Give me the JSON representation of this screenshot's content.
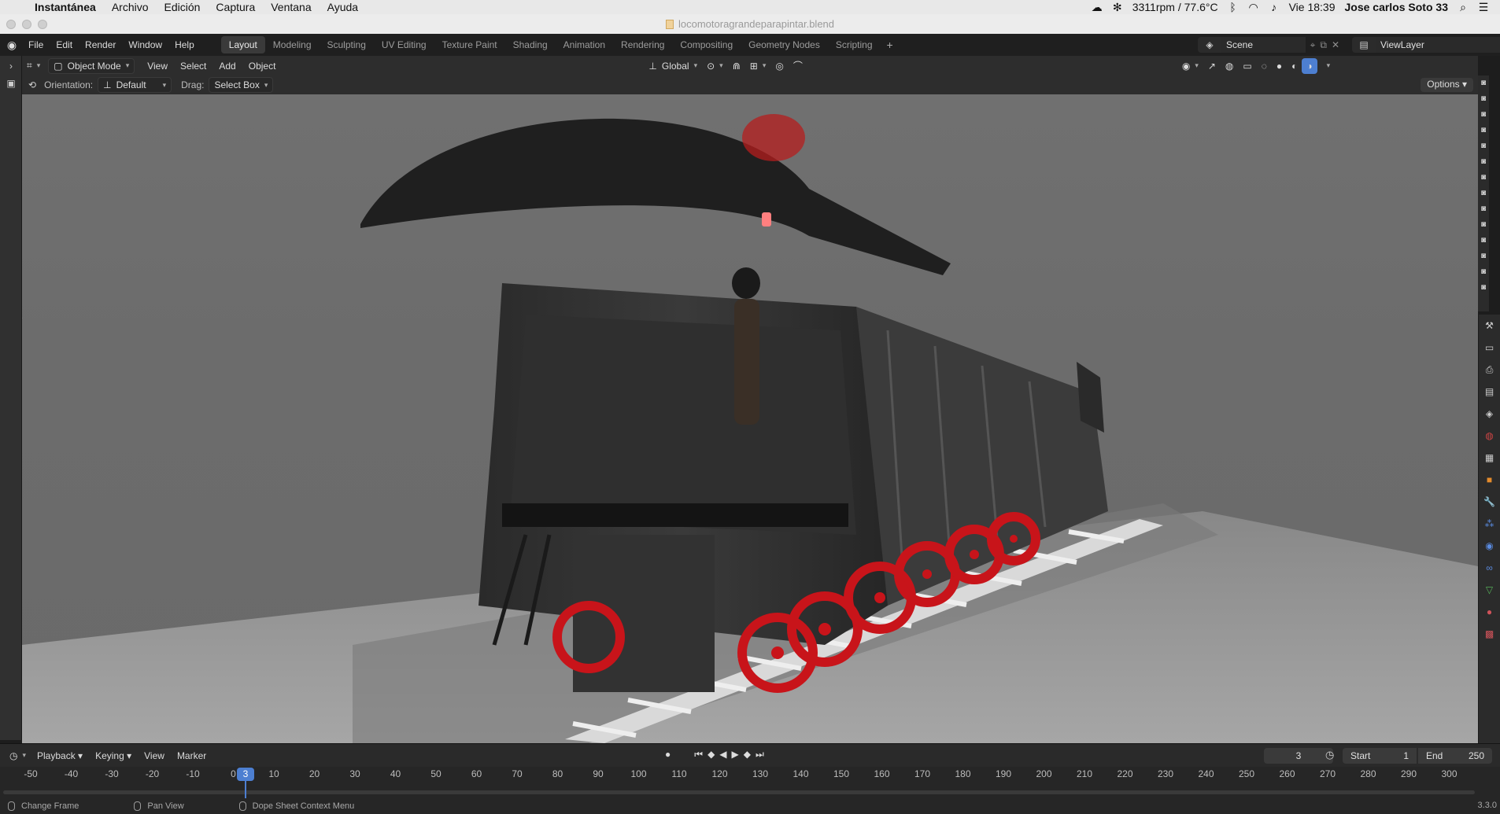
{
  "macos_menubar": {
    "app_name": "Instantánea",
    "items": [
      "Archivo",
      "Edición",
      "Captura",
      "Ventana",
      "Ayuda"
    ],
    "fan_status": "3311rpm / 77.6°C",
    "datetime": "Vie 18:39",
    "user": "Jose carlos Soto 33"
  },
  "window": {
    "title": "locomotoragrandeparapintar.blend"
  },
  "blender_menu": [
    "File",
    "Edit",
    "Render",
    "Window",
    "Help"
  ],
  "workspace_tabs": [
    {
      "label": "Layout",
      "active": true
    },
    {
      "label": "Modeling",
      "active": false
    },
    {
      "label": "Sculpting",
      "active": false
    },
    {
      "label": "UV Editing",
      "active": false
    },
    {
      "label": "Texture Paint",
      "active": false
    },
    {
      "label": "Shading",
      "active": false
    },
    {
      "label": "Animation",
      "active": false
    },
    {
      "label": "Rendering",
      "active": false
    },
    {
      "label": "Compositing",
      "active": false
    },
    {
      "label": "Geometry Nodes",
      "active": false
    },
    {
      "label": "Scripting",
      "active": false
    }
  ],
  "scene": {
    "name": "Scene"
  },
  "view_layer": {
    "name": "ViewLayer"
  },
  "viewport_header": {
    "mode": "Object Mode",
    "menus": [
      "View",
      "Select",
      "Add",
      "Object"
    ],
    "transform_orientation": "Global",
    "orientation_label": "Orientation:",
    "orientation_value": "Default",
    "drag_label": "Drag:",
    "drag_value": "Select Box",
    "options_label": "Options"
  },
  "timeline": {
    "menus": [
      "Playback",
      "Keying",
      "View",
      "Marker"
    ],
    "current_frame": "3",
    "start_label": "Start",
    "start_value": "1",
    "end_label": "End",
    "end_value": "250",
    "ruler_ticks": [
      "-50",
      "-40",
      "-30",
      "-20",
      "-10",
      "0",
      "10",
      "20",
      "30",
      "40",
      "50",
      "60",
      "70",
      "80",
      "90",
      "100",
      "110",
      "120",
      "130",
      "140",
      "150",
      "160",
      "170",
      "180",
      "190",
      "200",
      "210",
      "220",
      "230",
      "240",
      "250",
      "260",
      "270",
      "280",
      "290",
      "300"
    ]
  },
  "statusbar": {
    "items": [
      "Change Frame",
      "Pan View",
      "Dope Sheet Context Menu"
    ],
    "version": "3.3.0"
  },
  "colors": {
    "accent_blue": "#4d7fd1",
    "wheel_red": "#c8141a",
    "viewport_bg": "#6c6c6c"
  }
}
